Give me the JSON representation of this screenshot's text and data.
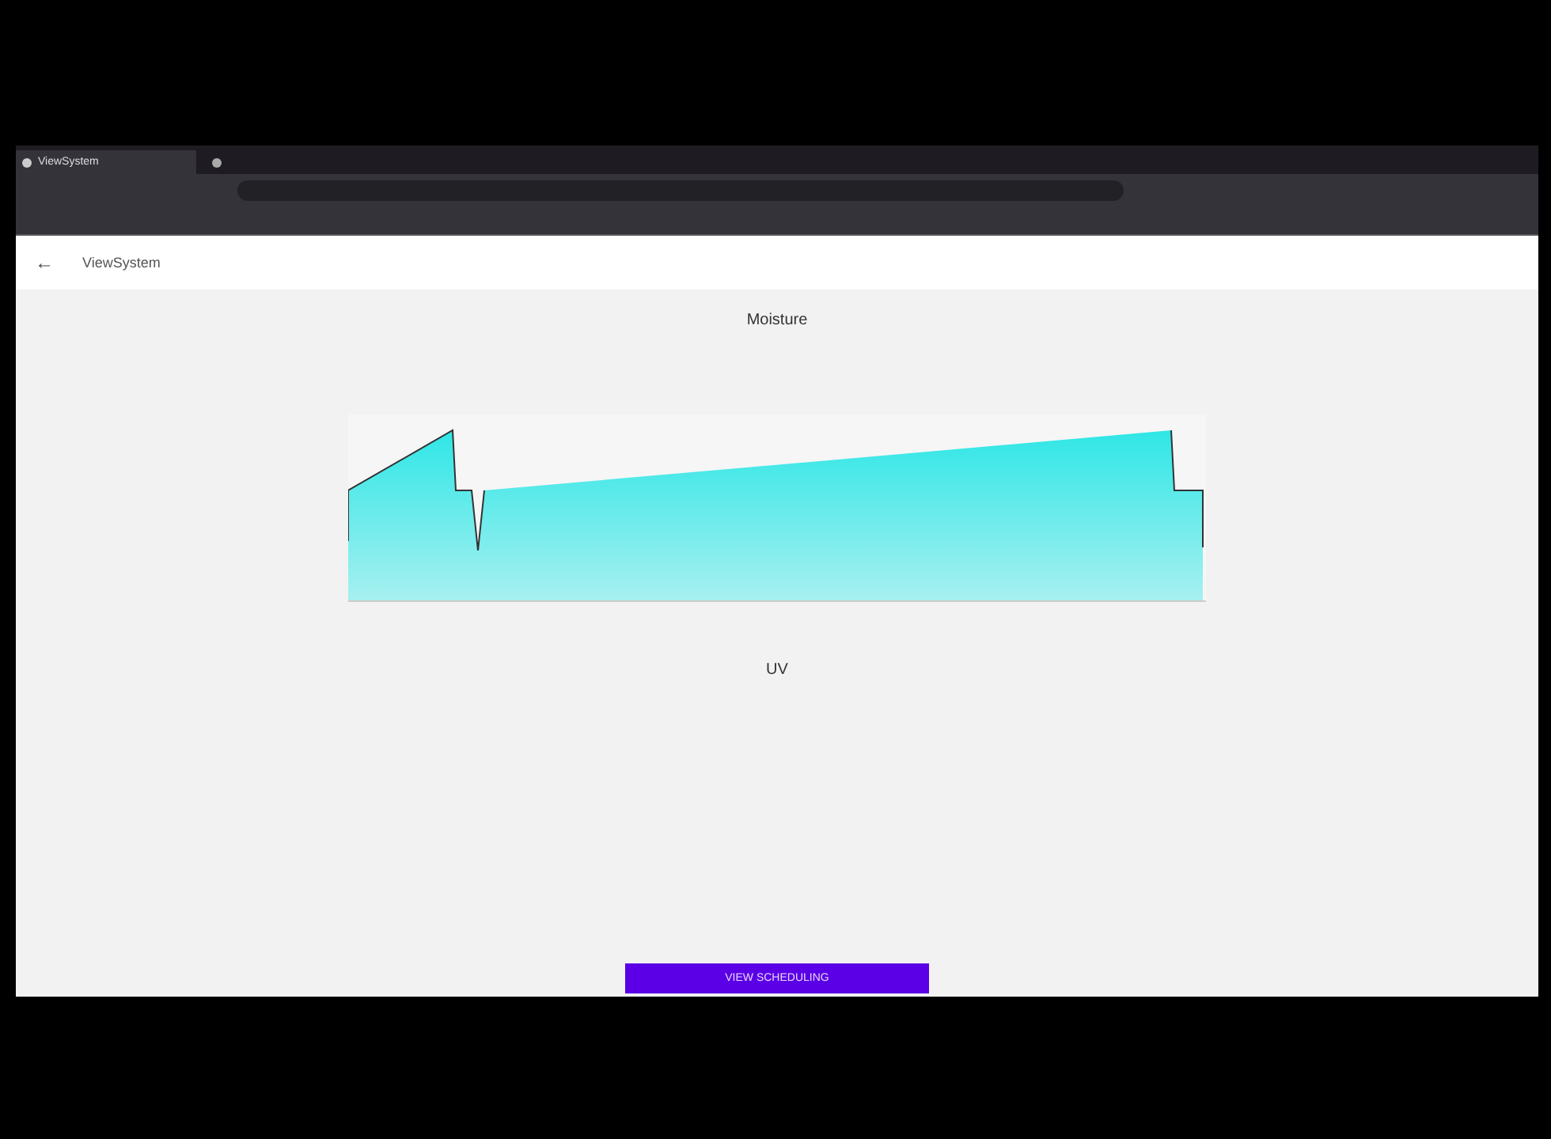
{
  "browser": {
    "tab_title": "ViewSystem"
  },
  "app_bar": {
    "back": "←",
    "title": "ViewSystem"
  },
  "sections": [
    {
      "title": "Moisture",
      "kind": "area"
    },
    {
      "title": "UV",
      "kind": "empty"
    }
  ],
  "button": "VIEW SCHEDULING"
}
